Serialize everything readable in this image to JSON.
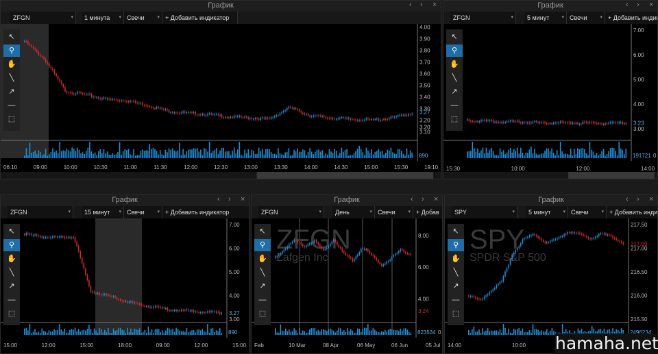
{
  "window_buttons": {
    "back": "‹",
    "fwd": "›",
    "close": "×"
  },
  "tools": [
    {
      "icon": "pointer-icon",
      "glyph": "↖",
      "active": false
    },
    {
      "icon": "zoom-icon",
      "glyph": "⚲",
      "active": true
    },
    {
      "icon": "hand-icon",
      "glyph": "✋",
      "active": false
    },
    {
      "icon": "line-tool-icon",
      "glyph": "╲",
      "active": false
    },
    {
      "icon": "arrow-tool-icon",
      "glyph": "↗",
      "active": false
    },
    {
      "icon": "hline-tool-icon",
      "glyph": "—",
      "active": false
    },
    {
      "icon": "rect-tool-icon",
      "glyph": "⬚",
      "active": false
    }
  ],
  "colors": {
    "up": "#1f8ed6",
    "down": "#d42a2a",
    "volume": "#1f8ed6",
    "background": "#000000",
    "accent": "#1f6ea8"
  },
  "panels": [
    {
      "id": "top-left",
      "title": "График",
      "toolbar": {
        "symbol": "ZFGN",
        "interval": "1 минута",
        "chart_type": "Свечи",
        "add_indicator": "+ Добавить индикатор"
      },
      "y_ticks": [
        "4.00",
        "3.90",
        "3.80",
        "3.70",
        "3.60",
        "3.50",
        "3.40",
        "3.30",
        "3.20",
        "3.10"
      ],
      "price_labels": [
        {
          "text": "3.27",
          "color": "#5ab0e8"
        },
        {
          "text": "3.20",
          "color": "#c8c8c8"
        }
      ],
      "volume_label": "890",
      "x_ticks": [
        "06:10",
        "09:00",
        "10:00",
        "10:30",
        "11:00",
        "11:30",
        "12:00",
        "12:30",
        "13:00",
        "13:30",
        "14:00",
        "14:30",
        "15:00",
        "15:30",
        "19:10"
      ],
      "chart_data": {
        "type": "candlestick",
        "price_range": [
          3.05,
          4.05
        ],
        "levels": [
          3.88,
          3.72,
          3.45,
          3.42,
          3.38,
          3.37,
          3.33,
          3.28,
          3.26,
          3.25,
          3.23,
          3.22,
          3.21,
          3.31,
          3.24,
          3.22,
          3.21,
          3.2,
          3.22,
          3.26
        ]
      }
    },
    {
      "id": "top-right",
      "title": "График",
      "toolbar": {
        "symbol": "ZFGN",
        "interval": "5 минут",
        "chart_type": "Свечи",
        "add_indicator": "+ Добавить индикатор"
      },
      "y_ticks": [
        "7.00",
        "6.00",
        "5.00",
        "4.00",
        "3.00"
      ],
      "price_labels": [
        {
          "text": "3.23",
          "color": "#5ab0e8"
        }
      ],
      "volume_label": "191721",
      "volume_zero": "0",
      "x_ticks": [
        "15:30",
        "10:00",
        "12:00",
        "14:00"
      ],
      "chart_data": {
        "type": "candlestick",
        "price_range": [
          2.8,
          7.2
        ],
        "levels": [
          3.35,
          3.3,
          3.28,
          3.27,
          3.26,
          3.25,
          3.24,
          3.24,
          3.22,
          3.21,
          3.23
        ]
      }
    },
    {
      "id": "bottom-left",
      "title": "График",
      "toolbar": {
        "symbol": "ZFGN",
        "interval": "15 минут",
        "chart_type": "Свечи",
        "add_indicator": "+ Добавить индикатор"
      },
      "y_ticks": [
        "7.00",
        "6.00",
        "5.00",
        "4.00",
        "3.00"
      ],
      "price_labels": [
        {
          "text": "3.27",
          "color": "#5ab0e8"
        }
      ],
      "volume_label": "890",
      "x_ticks": [
        "15:00",
        "12:00",
        "15:00",
        "18:00",
        "09:00",
        "12:00",
        "15:00"
      ],
      "chart_data": {
        "type": "candlestick",
        "price_range": [
          2.8,
          7.2
        ],
        "levels": [
          6.6,
          6.5,
          6.45,
          6.5,
          4.2,
          4.0,
          3.8,
          3.6,
          3.5,
          3.4,
          3.35,
          3.3,
          3.27
        ]
      }
    },
    {
      "id": "bottom-mid",
      "title": "График",
      "toolbar": {
        "symbol": "ZFGN",
        "interval": "День",
        "chart_type": "Свечи",
        "add_indicator": "+ Добав"
      },
      "watermark": {
        "symbol": "ZFGN",
        "name": "Zafgen Inc"
      },
      "y_ticks": [
        "8.00",
        "6.00",
        "4.00"
      ],
      "price_labels": [
        {
          "text": "3.24",
          "color": "#d42a2a"
        }
      ],
      "volume_label": "823534",
      "volume_zero": "0",
      "x_ticks": [
        "Feb",
        "10 Mar",
        "08 Apr",
        "06 May",
        "06 Jun",
        "05 Jul"
      ],
      "chart_data": {
        "type": "candlestick",
        "price_range": [
          2.5,
          9.0
        ],
        "levels": [
          6.6,
          7.2,
          7.7,
          7.3,
          7.7,
          7.0,
          7.8,
          6.9,
          6.4,
          7.3,
          6.7,
          6.1,
          6.6,
          7.1,
          6.8
        ]
      }
    },
    {
      "id": "bottom-right",
      "title": "График",
      "toolbar": {
        "symbol": "SPY",
        "interval": "5 минут",
        "chart_type": "Свечи",
        "add_indicator": "+ Добавить индикатор"
      },
      "watermark": {
        "symbol": "SPY",
        "name": "SPDR S&P 500"
      },
      "y_ticks": [
        "217.50",
        "217.00",
        "216.50",
        "216.00",
        "215.50"
      ],
      "price_labels": [
        {
          "text": "217.09",
          "color": "#d42a2a"
        }
      ],
      "volume_label": "2496234",
      "x_ticks": [
        "14:00",
        "10:00",
        "12:00",
        "14:00"
      ],
      "chart_data": {
        "type": "candlestick",
        "price_range": [
          215.4,
          217.6
        ],
        "levels": [
          216.0,
          215.9,
          216.1,
          216.3,
          216.9,
          217.2,
          217.3,
          217.1,
          217.2,
          217.35,
          217.3,
          217.2,
          217.3,
          217.25,
          217.1
        ]
      }
    }
  ],
  "stamp": "hamaha.net"
}
